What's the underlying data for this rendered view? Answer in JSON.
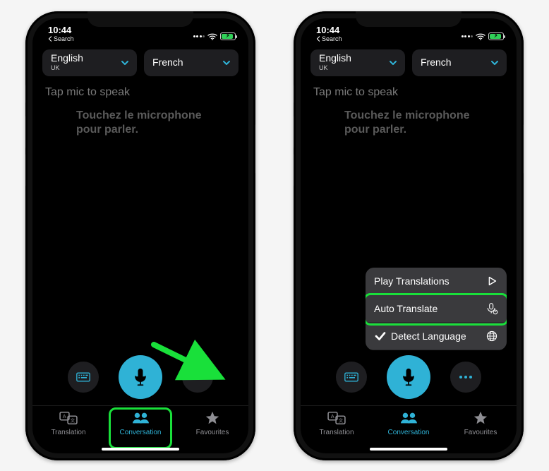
{
  "status": {
    "time": "10:44",
    "back_label": "Search"
  },
  "languages": {
    "left": {
      "name": "English",
      "sub": "UK"
    },
    "right": {
      "name": "French",
      "sub": ""
    }
  },
  "prompts": {
    "english": "Tap mic to speak",
    "french": "Touchez le microphone pour parler."
  },
  "tabs": {
    "translation": "Translation",
    "conversation": "Conversation",
    "favourites": "Favourites"
  },
  "menu": {
    "play": "Play Translations",
    "auto": "Auto Translate",
    "detect": "Detect Language"
  }
}
